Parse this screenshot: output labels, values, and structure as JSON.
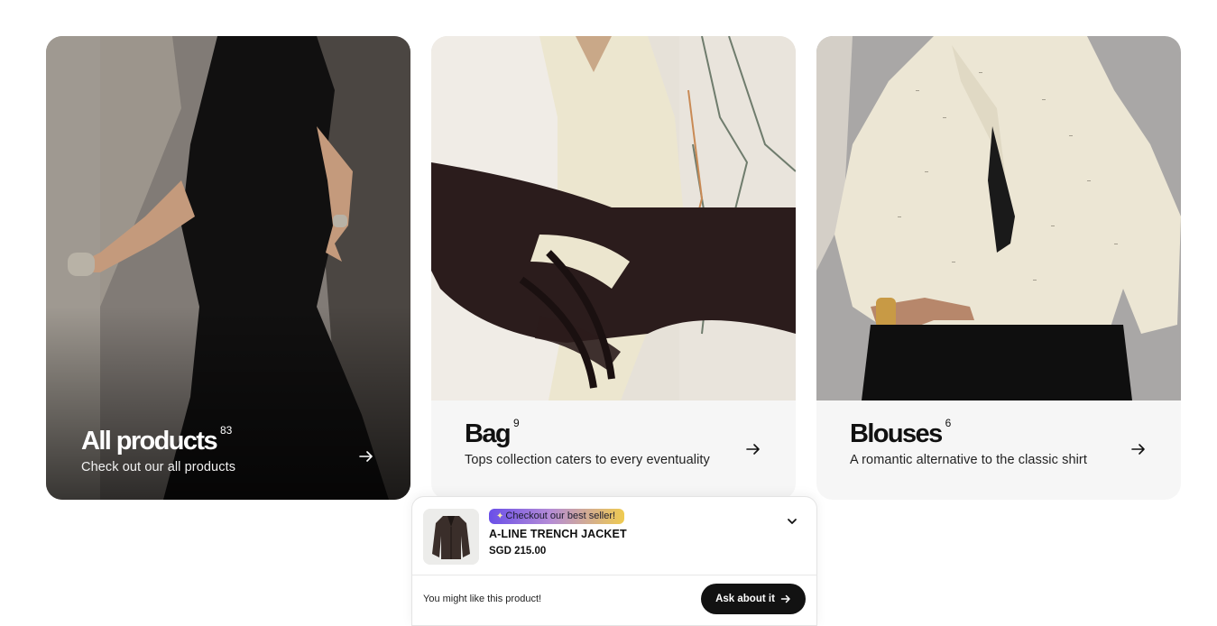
{
  "categories": [
    {
      "title": "All products",
      "count": "83",
      "description": "Check out our all products"
    },
    {
      "title": "Bag",
      "count": "9",
      "description": "Tops collection caters to every eventuality"
    },
    {
      "title": "Blouses",
      "count": "6",
      "description": "A romantic alternative to the classic shirt"
    }
  ],
  "popup": {
    "badge": "Checkout our best seller!",
    "product_name": "A-LINE TRENCH JACKET",
    "product_price": "SGD 215.00",
    "suggestion": "You might like this product!",
    "ask_button": "Ask about it"
  },
  "icons": {
    "arrow": "arrow-right-icon",
    "chevron": "chevron-down-icon",
    "badge_spark": "sparkle-icon",
    "ask_arrow": "arrow-right-icon"
  },
  "colors": {
    "badge_gradient_start": "#6a4fe8",
    "badge_gradient_end": "#efcb50",
    "button_bg": "#121212",
    "panel_bg": "#f6f6f6"
  }
}
